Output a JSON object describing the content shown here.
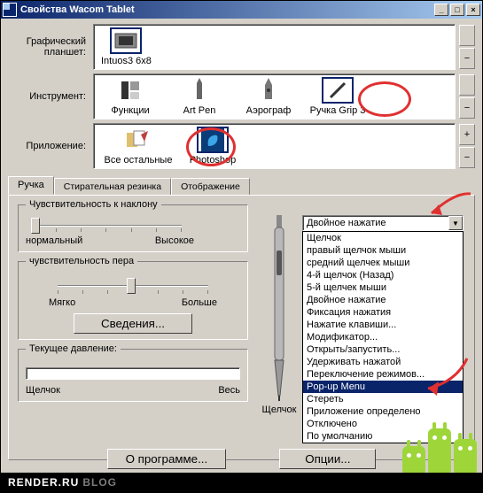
{
  "window": {
    "title": "Свойства Wacom Tablet"
  },
  "rows": {
    "tablet_label": "Графический\nпланшет:",
    "tool_label": "Инструмент:",
    "app_label": "Приложение:"
  },
  "tablets": [
    {
      "name": "Intuos3 6x8",
      "selected": true
    }
  ],
  "tools": [
    {
      "name": "Функции"
    },
    {
      "name": "Art Pen"
    },
    {
      "name": "Аэрограф"
    },
    {
      "name": "Ручка Grip 3",
      "selected": true
    }
  ],
  "apps": [
    {
      "name": "Все остальные"
    },
    {
      "name": "Photoshop",
      "selected": true
    }
  ],
  "tabs": {
    "pen": "Ручка",
    "eraser": "Стирательная резинка",
    "mapping": "Отображение"
  },
  "tilt": {
    "title": "Чувствительность к наклону",
    "low": "нормальный",
    "high": "Высокое"
  },
  "tip": {
    "title": "чувствительность пера",
    "low": "Мягко",
    "high": "Больше",
    "details_btn": "Сведения..."
  },
  "pressure": {
    "title": "Текущее давление:",
    "low": "Щелчок",
    "high": "Весь"
  },
  "pen_label": "Щелчок",
  "dropdown": {
    "selected": "Двойное нажатие",
    "items": [
      "Щелчок",
      "правый щелчок мыши",
      "средний щелчек мыши",
      "4-й щелчок (Назад)",
      "5-й щелчек мыши",
      "Двойное нажатие",
      "Фиксация нажатия",
      "Нажатие клавиши...",
      "Модификатор...",
      "Открыть/запустить...",
      "Удерживать нажатой",
      "Переключение режимов...",
      "Pop-up Menu",
      "Стереть",
      "Приложение определено",
      "Отключено",
      "По умолчанию"
    ],
    "highlighted_index": 12
  },
  "buttons": {
    "about": "О программе...",
    "options": "Опции..."
  },
  "footer": {
    "site": "RENDER.RU",
    "sub": "BLOG"
  }
}
